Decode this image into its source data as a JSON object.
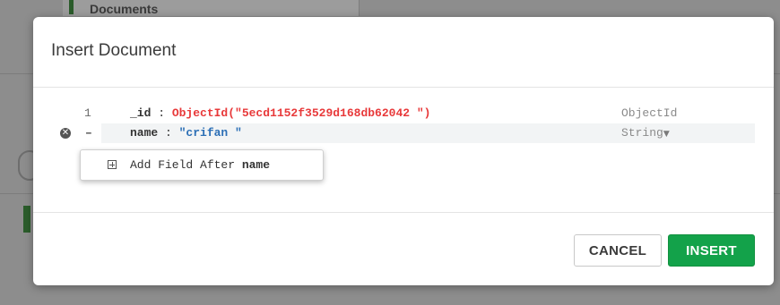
{
  "background": {
    "tab_label": "Documents"
  },
  "modal": {
    "title": "Insert Document",
    "rows": [
      {
        "line": "1",
        "key": "_id",
        "colon": " : ",
        "value": "ObjectId(\"5ecd1152f3529d168db62042 \")",
        "type": "ObjectId"
      },
      {
        "marker": "–",
        "key": "name",
        "colon": " : ",
        "value": "\"crifan \"",
        "type": "String"
      }
    ],
    "context_menu": {
      "label": "Add Field After ",
      "field": "name"
    },
    "buttons": {
      "cancel": "CANCEL",
      "insert": "INSERT"
    }
  },
  "colors": {
    "insert_green": "#13a24a",
    "value_red": "#e8393a",
    "value_blue": "#2c6fb6"
  },
  "icons": {
    "remove": "x-circle-icon",
    "add_field": "plus-square-icon",
    "type_caret": "caret-down-icon"
  }
}
